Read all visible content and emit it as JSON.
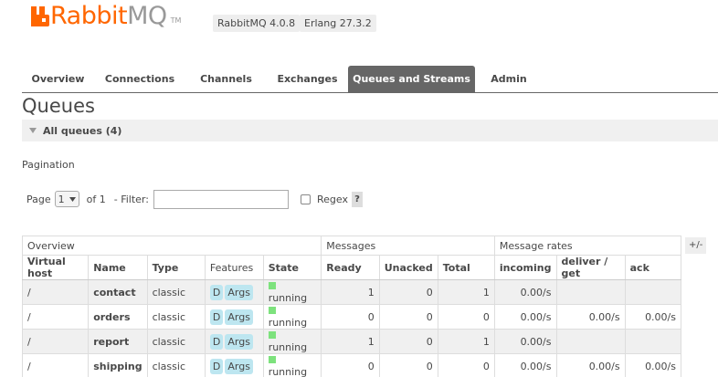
{
  "header": {
    "brand_rabbit": "Rabbit",
    "brand_mq": "MQ",
    "tm": "TM",
    "version_rabbit": "RabbitMQ 4.0.8",
    "version_erlang": "Erlang 27.3.2"
  },
  "tabs": [
    {
      "label": "Overview"
    },
    {
      "label": "Connections"
    },
    {
      "label": "Channels"
    },
    {
      "label": "Exchanges"
    },
    {
      "label": "Queues and Streams",
      "active": true
    },
    {
      "label": "Admin"
    }
  ],
  "page_title": "Queues",
  "section": {
    "title": "All queues (4)"
  },
  "pagination": {
    "label": "Pagination",
    "page_label": "Page",
    "page_value": "1",
    "of_label": "of 1",
    "filter_label": "- Filter:",
    "filter_value": "",
    "regex_label": "Regex",
    "help": "?"
  },
  "table": {
    "group_headers": {
      "overview": "Overview",
      "messages": "Messages",
      "rates": "Message rates"
    },
    "plus_minus": "+/-",
    "columns": {
      "vhost": "Virtual host",
      "name": "Name",
      "type": "Type",
      "features": "Features",
      "state": "State",
      "ready": "Ready",
      "unacked": "Unacked",
      "total": "Total",
      "incoming": "incoming",
      "deliver_get": "deliver / get",
      "ack": "ack"
    },
    "rows": [
      {
        "vhost": "/",
        "name": "contact",
        "type": "classic",
        "feature_d": "D",
        "feature_args": "Args",
        "state": "running",
        "ready": "1",
        "unacked": "0",
        "total": "1",
        "incoming": "0.00/s",
        "deliver_get": "",
        "ack": ""
      },
      {
        "vhost": "/",
        "name": "orders",
        "type": "classic",
        "feature_d": "D",
        "feature_args": "Args",
        "state": "running",
        "ready": "0",
        "unacked": "0",
        "total": "0",
        "incoming": "0.00/s",
        "deliver_get": "0.00/s",
        "ack": "0.00/s"
      },
      {
        "vhost": "/",
        "name": "report",
        "type": "classic",
        "feature_d": "D",
        "feature_args": "Args",
        "state": "running",
        "ready": "1",
        "unacked": "0",
        "total": "1",
        "incoming": "0.00/s",
        "deliver_get": "",
        "ack": ""
      },
      {
        "vhost": "/",
        "name": "shipping",
        "type": "classic",
        "feature_d": "D",
        "feature_args": "Args",
        "state": "running",
        "ready": "0",
        "unacked": "0",
        "total": "0",
        "incoming": "0.00/s",
        "deliver_get": "0.00/s",
        "ack": "0.00/s"
      }
    ]
  },
  "colors": {
    "brand_orange": "#ff6600",
    "active_tab": "#666666",
    "badge": "#bde6f0",
    "running": "#7de27d"
  }
}
